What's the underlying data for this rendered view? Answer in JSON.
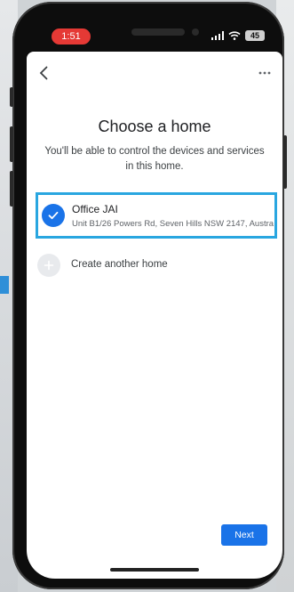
{
  "status_bar": {
    "time": "1:51",
    "battery": "45",
    "icons": [
      "signal-icon",
      "wifi-icon",
      "battery-icon"
    ]
  },
  "colors": {
    "accent": "#1a73e8",
    "selection_outline": "#29a6e0",
    "time_pill": "#e53935"
  },
  "header": {
    "back_icon": "back-arrow-icon",
    "more_icon": "more-options-icon"
  },
  "page": {
    "title": "Choose a home",
    "subtitle": "You'll be able to control the devices and services in this home."
  },
  "homes": [
    {
      "name": "Office JAI",
      "address": "Unit B1/26 Powers Rd, Seven Hills NSW 2147, Austra",
      "selected": true
    }
  ],
  "create_home": {
    "label": "Create another home"
  },
  "footer": {
    "next_label": "Next"
  }
}
